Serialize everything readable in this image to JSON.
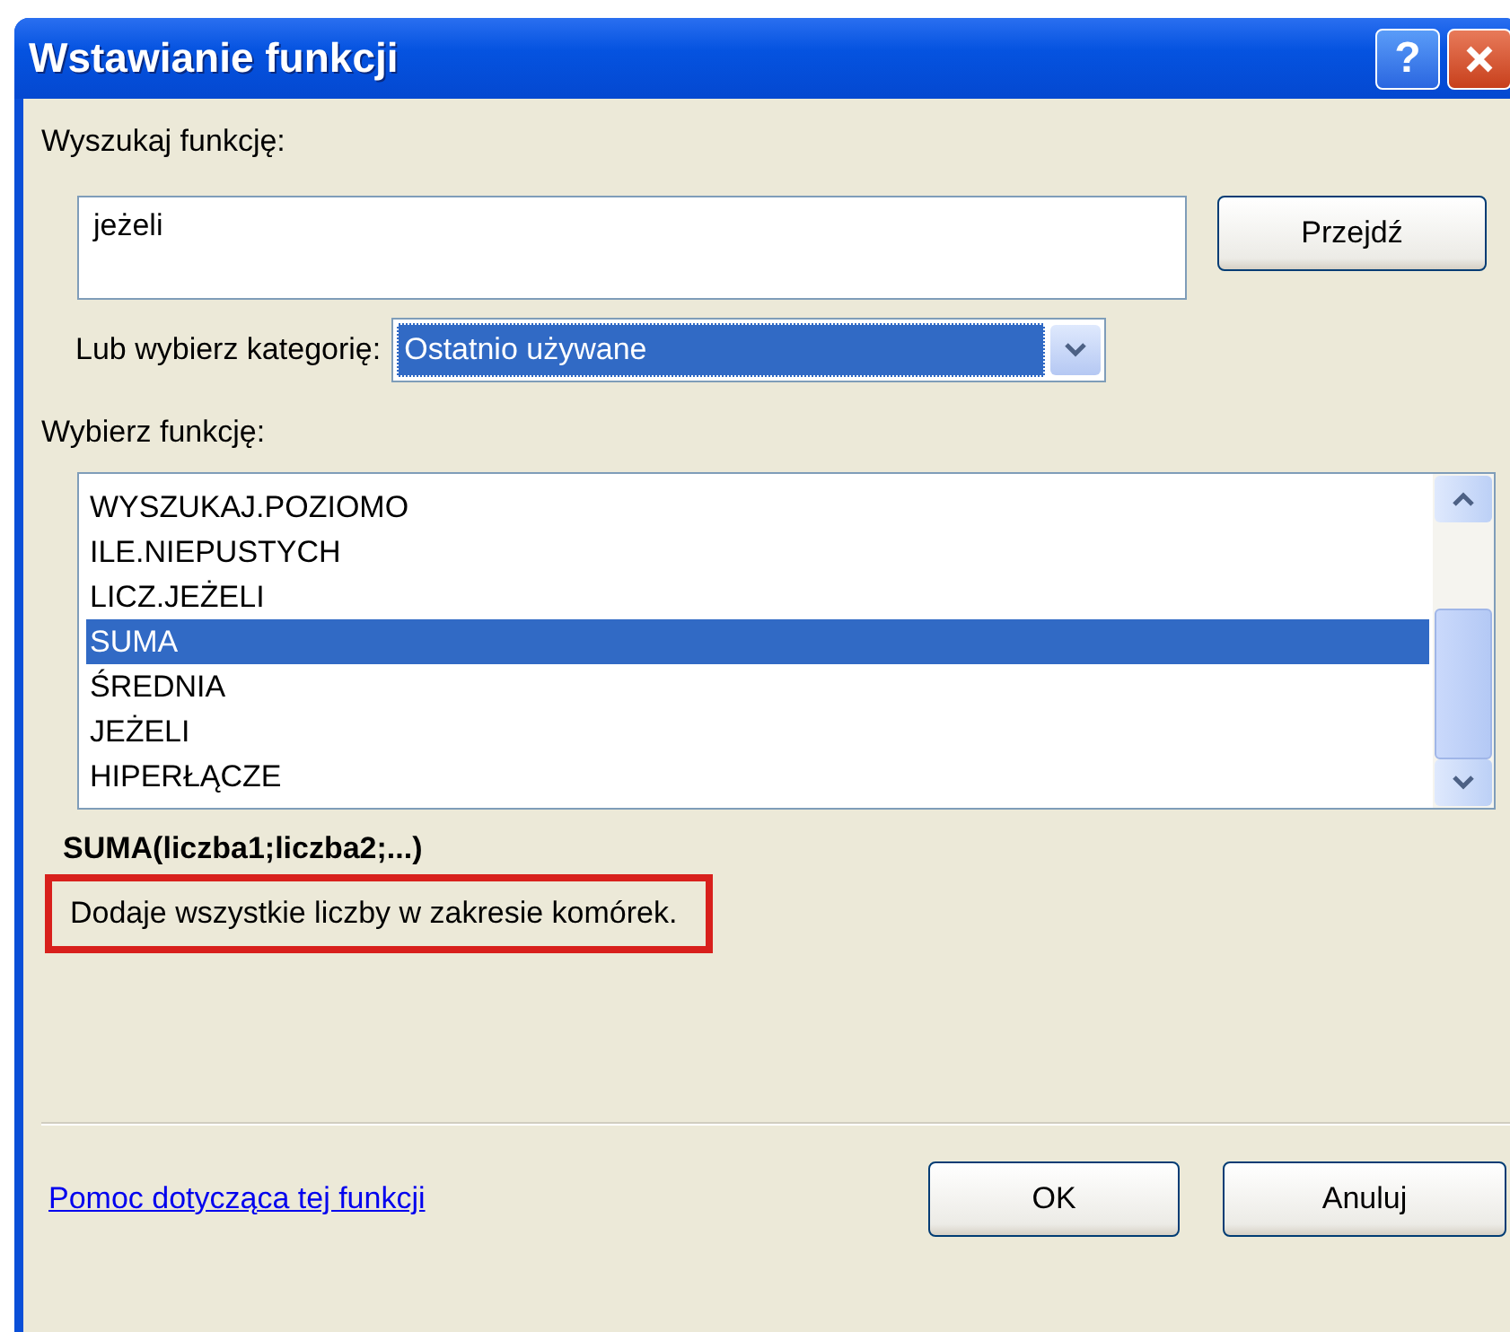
{
  "window": {
    "title": "Wstawianie funkcji",
    "buttons": [
      "?"
    ]
  },
  "search": {
    "label": "Wyszukaj funkcję:",
    "value": "jeżeli",
    "button": "Przejdź"
  },
  "category": {
    "label": "Lub wybierz kategorię:",
    "value": "Ostatnio używane"
  },
  "functions": {
    "label": "Wybierz funkcję:",
    "items": [
      {
        "label": "WYSZUKAJ.POZIOMO",
        "selected": false
      },
      {
        "label": "ILE.NIEPUSTYCH",
        "selected": false
      },
      {
        "label": "LICZ.JEŻELI",
        "selected": false
      },
      {
        "label": "SUMA",
        "selected": true
      },
      {
        "label": "ŚREDNIA",
        "selected": false
      },
      {
        "label": "JEŻELI",
        "selected": false
      },
      {
        "label": "HIPERŁĄCZE",
        "selected": false
      }
    ]
  },
  "syntax": "SUMA(liczba1;liczba2;...)",
  "description": {
    "text": "Dodaje wszystkie liczby w zakresie komórek.",
    "highlighted": true
  },
  "help_link": "Pomoc dotycząca tej funkcji",
  "buttons": [
    "OK",
    "Anuluj"
  ]
}
